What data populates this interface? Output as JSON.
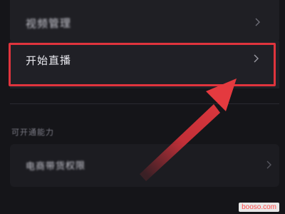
{
  "menu": {
    "items": [
      {
        "label": "视频管理"
      },
      {
        "label": "开始直播"
      }
    ]
  },
  "available_section": {
    "title": "可开通能力",
    "items": [
      {
        "label": "电商带货权限"
      }
    ]
  },
  "watermark": {
    "text": "booso.com"
  },
  "colors": {
    "background": "#151519",
    "card": "#202026",
    "highlight": "#e0343d",
    "arrow": "#e0343d"
  },
  "icons": {
    "chevron": "chevron-right-icon"
  }
}
